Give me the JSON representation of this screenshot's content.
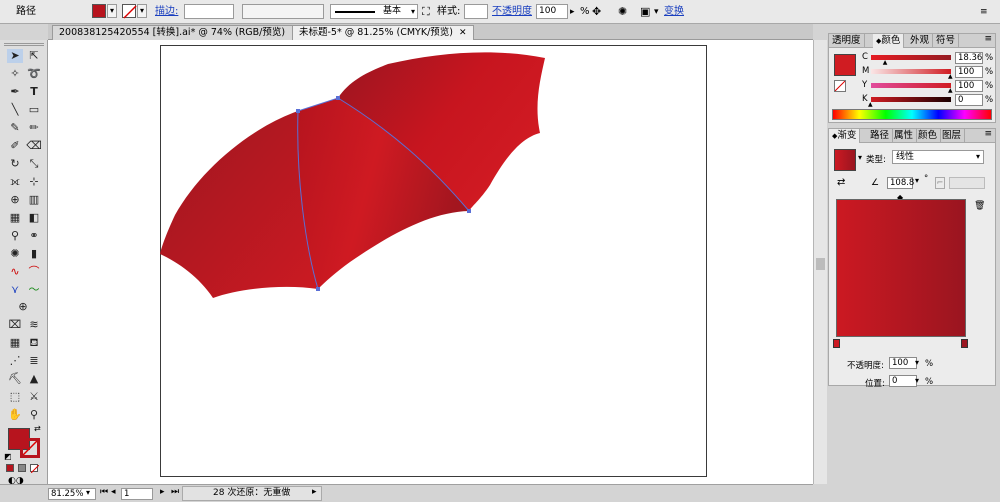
{
  "control_bar": {
    "object_type": "路径",
    "stroke_label": "描边:",
    "stroke_style": "基本",
    "style_label": "样式:",
    "opacity_label": "不透明度",
    "opacity_value": "100",
    "opacity_unit": "%",
    "transform_link": "变换",
    "fill_color": "#b7141e"
  },
  "tabs": [
    {
      "label": "200838125420554 [转换].ai* @ 74% (RGB/预览)"
    },
    {
      "label": "未标题-5* @ 81.25% (CMYK/预览)"
    }
  ],
  "status": {
    "zoom": "81.25%",
    "page": "1",
    "undo_text": "28 次还原：无重做"
  },
  "color_panel": {
    "tabs": [
      "透明度",
      "颜色",
      "外观",
      "符号"
    ],
    "active_tab": "颜色",
    "channels": [
      {
        "name": "C",
        "value": "18.36",
        "level": 0.1836
      },
      {
        "name": "M",
        "value": "100",
        "level": 1.0
      },
      {
        "name": "Y",
        "value": "100",
        "level": 1.0
      },
      {
        "name": "K",
        "value": "0",
        "level": 0.0
      }
    ]
  },
  "gradient_panel": {
    "tabs": [
      "渐变",
      "路径",
      "属性",
      "颜色",
      "图层"
    ],
    "active_tab": "渐变",
    "type_label": "类型:",
    "type_value": "线性",
    "angle": "108.8",
    "angle_unit": "°",
    "opacity_label": "不透明度:",
    "opacity_value": "100",
    "location_label": "位置:",
    "location_value": "0",
    "percent": "%",
    "color_start": "#cc1922",
    "color_end": "#9a1520"
  },
  "icons": {
    "selection": "selection-arrow-icon",
    "direct_selection": "direct-selection-icon"
  }
}
